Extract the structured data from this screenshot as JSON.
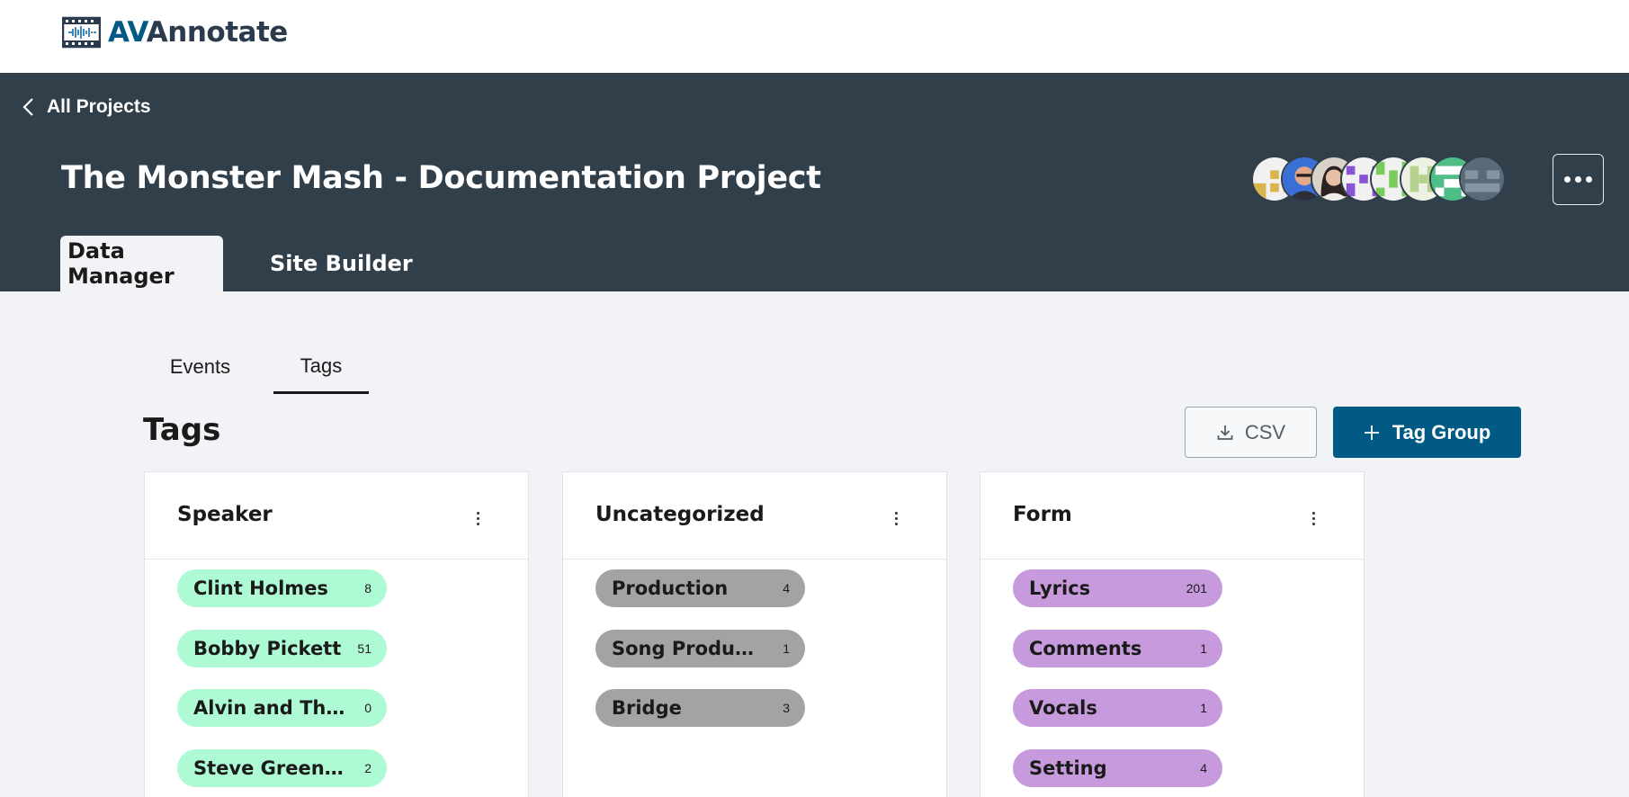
{
  "app": {
    "logo_primary": "AV",
    "logo_secondary": "Annotate",
    "logo_icon": "film-waveform-icon",
    "brand_color": "#005a84"
  },
  "header": {
    "back_label": "All Projects",
    "project_title": "The Monster Mash - Documentation Project",
    "background_color": "#313f4b"
  },
  "main_tabs": [
    {
      "label": "Data Manager",
      "active": true
    },
    {
      "label": "Site Builder",
      "active": false
    }
  ],
  "sub_tabs": [
    {
      "label": "Events",
      "active": false
    },
    {
      "label": "Tags",
      "active": true
    }
  ],
  "page": {
    "heading": "Tags"
  },
  "actions": {
    "csv_label": "CSV",
    "tag_group_label": "Tag Group"
  },
  "tag_groups": [
    {
      "title": "Speaker",
      "color": "#aefad5",
      "tags": [
        {
          "name": "Clint Holmes",
          "count": "8"
        },
        {
          "name": "Bobby Pickett",
          "count": "51"
        },
        {
          "name": "Alvin and Theo...",
          "count": "0"
        },
        {
          "name": "Steve Greenberg",
          "count": "2"
        }
      ]
    },
    {
      "title": "Uncategorized",
      "color": "#a3a3a3",
      "tags": [
        {
          "name": "Production",
          "count": "4"
        },
        {
          "name": "Song Production",
          "count": "1"
        },
        {
          "name": "Bridge",
          "count": "3"
        }
      ]
    },
    {
      "title": "Form",
      "color": "#c79add",
      "tags": [
        {
          "name": "Lyrics",
          "count": "201"
        },
        {
          "name": "Comments",
          "count": "1"
        },
        {
          "name": "Vocals",
          "count": "1"
        },
        {
          "name": "Setting",
          "count": "4"
        }
      ]
    }
  ]
}
